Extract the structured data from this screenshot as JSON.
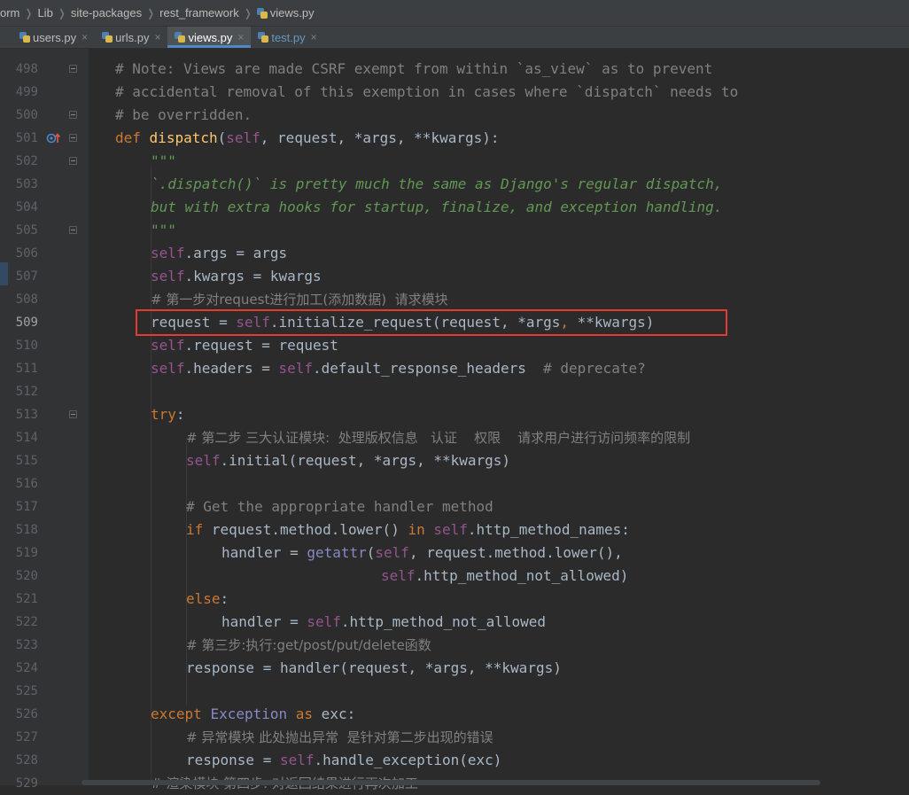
{
  "breadcrumb": [
    {
      "label": "orm"
    },
    {
      "label": "Lib"
    },
    {
      "label": "site-packages"
    },
    {
      "label": "rest_framework"
    },
    {
      "label": "views.py",
      "icon": "python-file-icon"
    }
  ],
  "tabs": [
    {
      "label": "users.py",
      "active": false
    },
    {
      "label": "urls.py",
      "active": false
    },
    {
      "label": "views.py",
      "active": true
    },
    {
      "label": "test.py",
      "active": false
    }
  ],
  "tab_close_glyph": "×",
  "colors": {
    "background": "#2b2b2b",
    "gutter": "#313335",
    "comment": "#808080",
    "docstring": "#629755",
    "keyword": "#cc7832",
    "self": "#94558d",
    "function": "#ffc66d",
    "highlight_box": "#e53935"
  },
  "line_numbers": [
    "498",
    "499",
    "500",
    "501",
    "502",
    "503",
    "504",
    "505",
    "506",
    "507",
    "508",
    "509",
    "510",
    "511",
    "512",
    "513",
    "514",
    "515",
    "516",
    "517",
    "518",
    "519",
    "520",
    "521",
    "522",
    "523",
    "524",
    "525",
    "526",
    "527",
    "528",
    "529"
  ],
  "code": {
    "l498": "# Note: Views are made CSRF exempt from within `as_view` as to prevent",
    "l499": "# accidental removal of this exemption in cases where `dispatch` needs to",
    "l500": "# be overridden.",
    "l501": {
      "def": "def",
      "name": "dispatch",
      "open": "(",
      "self": "self",
      "rest": ", request, *args, **kwargs):"
    },
    "l502": "\"\"\"",
    "l503": "`.dispatch()` is pretty much the same as Django's regular dispatch,",
    "l504": "but with extra hooks for startup, finalize, and exception handling.",
    "l505": "\"\"\"",
    "l506": {
      "self": "self",
      "rest": ".args = args"
    },
    "l507": {
      "self": "self",
      "rest": ".kwargs = kwargs"
    },
    "l508": "# 第一步对request进行加工(添加数据)  请求模块",
    "l509": {
      "pre": "request = ",
      "self": "self",
      "mid": ".initialize_request(request, ",
      "a1": "*args",
      "comma": ", ",
      "a2": "**kwargs",
      "end": ")"
    },
    "l510": {
      "self": "self",
      "rest": ".request = request"
    },
    "l511": {
      "self1": "self",
      "mid": ".headers = ",
      "self2": "self",
      "rest": ".default_response_headers  ",
      "comment": "# deprecate?"
    },
    "l513": {
      "kw": "try",
      "rest": ":"
    },
    "l514": "# 第二步 三大认证模块:  处理版权信息   认证    权限    请求用户进行访问频率的限制",
    "l515": {
      "self": "self",
      "rest": ".initial(request, *args, **kwargs)"
    },
    "l517": "# Get the appropriate handler method",
    "l518": {
      "kw1": "if",
      "mid": " request.method.lower() ",
      "kw2": "in",
      "sp": " ",
      "self": "self",
      "rest": ".http_method_names:"
    },
    "l519": {
      "pre": "handler = ",
      "fn": "getattr",
      "open": "(",
      "self": "self",
      "rest": ", request.method.lower(),"
    },
    "l520": {
      "self": "self",
      "rest": ".http_method_not_allowed)"
    },
    "l521": {
      "kw": "else",
      "rest": ":"
    },
    "l522": {
      "pre": "handler = ",
      "self": "self",
      "rest": ".http_method_not_allowed"
    },
    "l523": "# 第三步:执行:get/post/put/delete函数",
    "l524": "response = handler(request, *args, **kwargs)",
    "l526": {
      "kw1": "except",
      "sp": " ",
      "cls": "Exception",
      "sp2": " ",
      "kw2": "as",
      "rest": " exc:"
    },
    "l527": "# 异常模块 此处抛出异常  是针对第二步出现的错误",
    "l528": {
      "pre": "response = ",
      "self": "self",
      "rest": ".handle_exception(exc)"
    },
    "l529": "# 渲染模块 第四步: 对返回结果进行再次加工"
  }
}
